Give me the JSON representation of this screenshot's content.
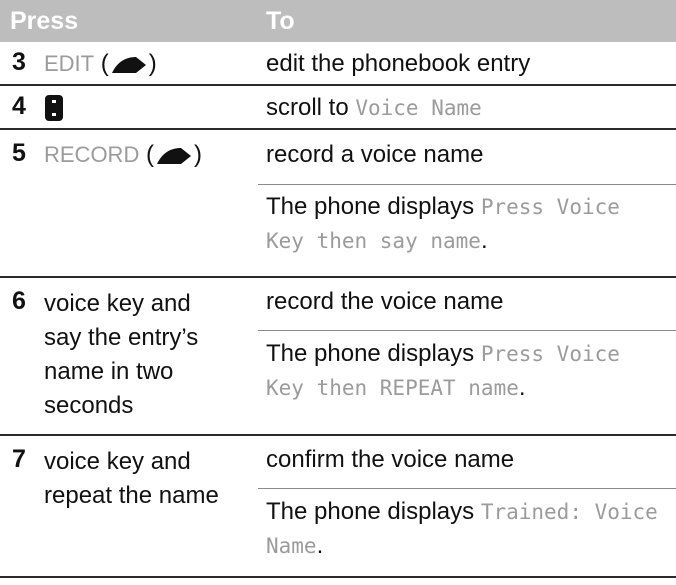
{
  "header": {
    "col_press": "Press",
    "col_to": "To"
  },
  "rows": [
    {
      "num": "3",
      "press_key": "EDIT",
      "to": "edit the phonebook entry"
    },
    {
      "num": "4",
      "to_prefix": "scroll to ",
      "to_display": "Voice Name"
    },
    {
      "num": "5",
      "press_key": "RECORD",
      "to": "record a voice name",
      "note_prefix": "The phone displays ",
      "note_display_1": "Press Voice",
      "note_display_2": "Key then say name",
      "note_suffix": "."
    },
    {
      "num": "6",
      "press_lines": [
        "voice key and",
        "say the entry’s",
        "name in two",
        "seconds"
      ],
      "to": "record the voice name",
      "note_prefix": "The phone displays ",
      "note_display_1": "Press Voice",
      "note_display_2": "Key then REPEAT name",
      "note_suffix": "."
    },
    {
      "num": "7",
      "press_lines": [
        "voice key and",
        "repeat the name"
      ],
      "to": "confirm the voice name",
      "note_prefix": "The phone displays ",
      "note_display_1": "Trained: Voice",
      "note_display_2": "Name",
      "note_suffix": "."
    }
  ],
  "icons": {
    "softkey": "right-softkey-icon",
    "nav": "navigation-key-icon"
  },
  "colors": {
    "header_bg": "#bdbdbd",
    "display_text": "#9b9b9b",
    "rule": "#2a2a2a"
  }
}
